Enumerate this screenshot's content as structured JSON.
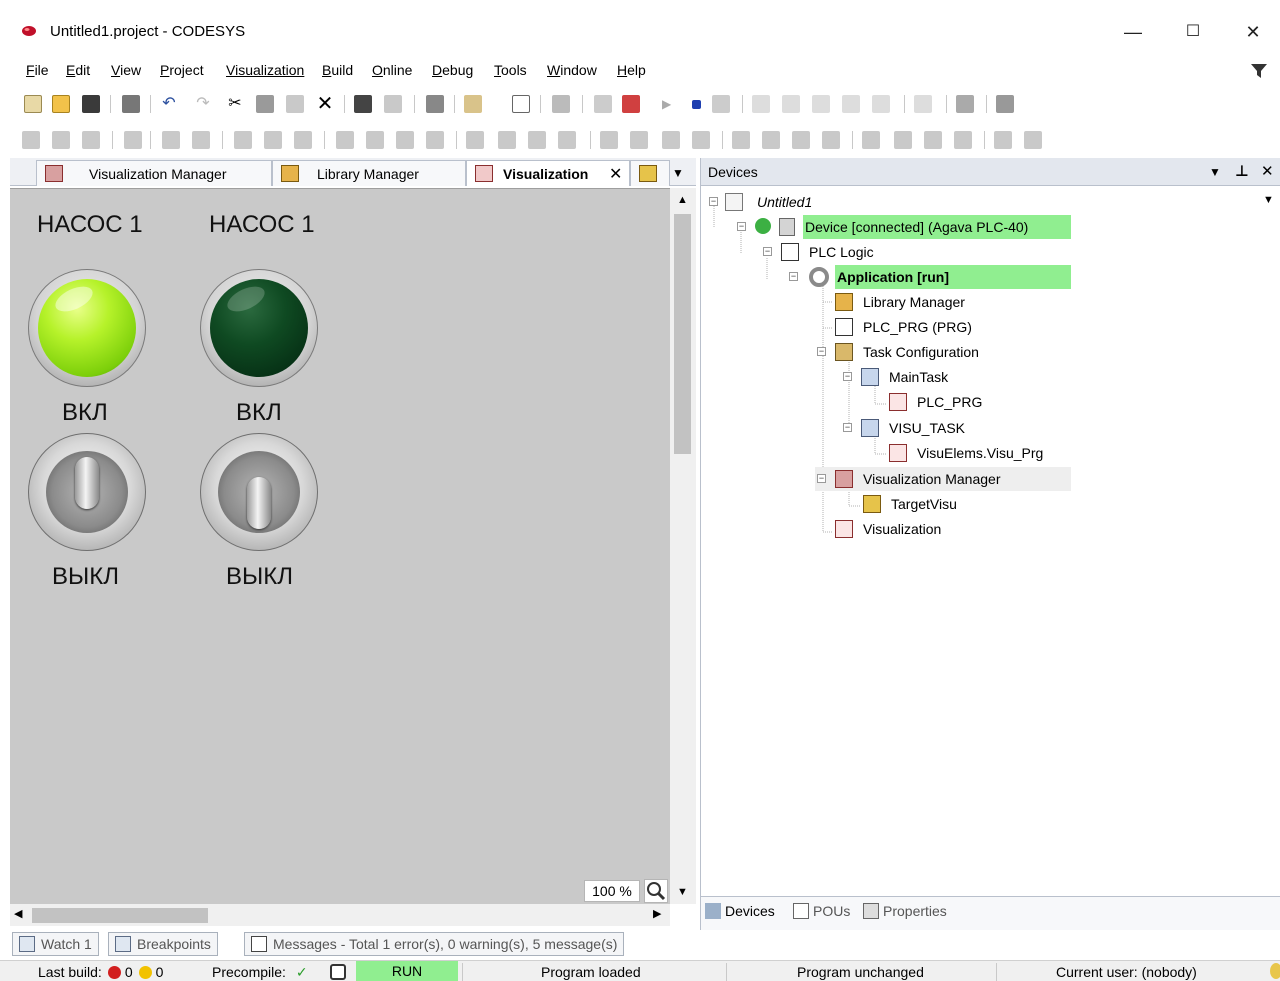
{
  "window": {
    "title": "Untitled1.project - CODESYS",
    "minimize": "—",
    "maximize": "☐",
    "close": "✕"
  },
  "menu": {
    "items": [
      {
        "underline": "F",
        "rest": "ile"
      },
      {
        "underline": "E",
        "rest": "dit"
      },
      {
        "underline": "V",
        "rest": "iew"
      },
      {
        "underline": "P",
        "rest": "roject"
      },
      {
        "underline": "",
        "rest": "Visualization"
      },
      {
        "underline": "B",
        "rest": "uild"
      },
      {
        "underline": "O",
        "rest": "nline"
      },
      {
        "underline": "D",
        "rest": "ebug"
      },
      {
        "underline": "T",
        "rest": "ools"
      },
      {
        "underline": "W",
        "rest": "indow"
      },
      {
        "underline": "H",
        "rest": "elp"
      }
    ]
  },
  "doc_tabs": {
    "visu_manager": "Visualization Manager",
    "library_manager": "Library Manager",
    "visualization": "Visualization",
    "close": "✕",
    "overflow": "▼"
  },
  "visualization": {
    "pump1_title": "НАСОС 1",
    "pump2_title": "НАСОС 1",
    "pump1_lamp_label": "ВКЛ",
    "pump2_lamp_label": "ВКЛ",
    "pump1_switch_label": "ВЫКЛ",
    "pump2_switch_label": "ВЫКЛ",
    "pump1_lamp_state": "on",
    "pump2_lamp_state": "off",
    "zoom": "100 %"
  },
  "devices_panel": {
    "title": "Devices",
    "tree": {
      "root": "Untitled1",
      "device": "Device [connected] (Agava PLC-40)",
      "plc_logic": "PLC Logic",
      "application": "Application [run]",
      "library_manager": "Library Manager",
      "plc_prg": "PLC_PRG (PRG)",
      "task_configuration": "Task Configuration",
      "main_task": "MainTask",
      "main_task_prg": "PLC_PRG",
      "visu_task": "VISU_TASK",
      "visu_task_prg": "VisuElems.Visu_Prg",
      "visualization_manager": "Visualization Manager",
      "target_visu": "TargetVisu",
      "visualization": "Visualization"
    },
    "tabs": {
      "devices": "Devices",
      "pous": "POUs",
      "properties": "Properties"
    }
  },
  "bottom_tabs": {
    "watch": "Watch 1",
    "breakpoints": "Breakpoints",
    "messages": "Messages - Total 1 error(s), 0 warning(s), 5 message(s)"
  },
  "status": {
    "last_build_label": "Last build:",
    "errors": "0",
    "warnings": "0",
    "precompile_label": "Precompile:",
    "precompile_ok": "✓",
    "run": "RUN",
    "program_loaded": "Program loaded",
    "program_unchanged": "Program unchanged",
    "current_user": "Current user: (nobody)"
  },
  "colors": {
    "highlight_green": "#90ee90",
    "visu_background": "#c9c9c9",
    "lamp_on": "#b6f22a",
    "lamp_off": "#0f4a22"
  }
}
